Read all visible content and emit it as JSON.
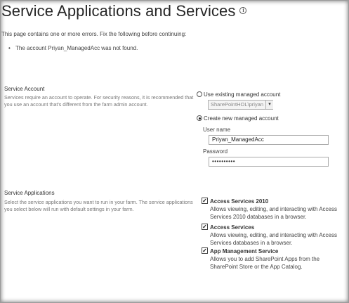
{
  "page": {
    "title": "Service Applications and Services",
    "info_icon": "info-icon"
  },
  "errors": {
    "intro": "This page contains one or more errors. Fix the following before continuing:",
    "items": [
      "The account Priyan_ManagedAcc was not found."
    ]
  },
  "service_account": {
    "title": "Service Account",
    "description": "Services require an account to operate. For security reasons, it is recommended that you use an account that's different from the farm admin account.",
    "option_existing_label": "Use existing managed account",
    "existing_account_value": "SharePointHOL\\priyan",
    "option_new_label": "Create new managed account",
    "selected_option": "new",
    "user_name_label": "User name",
    "user_name_value": "Priyan_ManagedAcc",
    "password_label": "Password",
    "password_value": "••••••••••"
  },
  "service_applications": {
    "title": "Service Applications",
    "description": "Select the service applications you want to run in your farm. The service applications you select below will run with default settings in your farm.",
    "items": [
      {
        "name": "Access Services 2010",
        "description": "Allows viewing, editing, and interacting with Access Services 2010 databases in a browser.",
        "checked": true
      },
      {
        "name": "Access Services",
        "description": "Allows viewing, editing, and interacting with Access Services databases in a browser.",
        "checked": true
      },
      {
        "name": "App Management Service",
        "description": "Allows you to add SharePoint Apps from the SharePoint Store or the App Catalog.",
        "checked": true
      }
    ]
  }
}
